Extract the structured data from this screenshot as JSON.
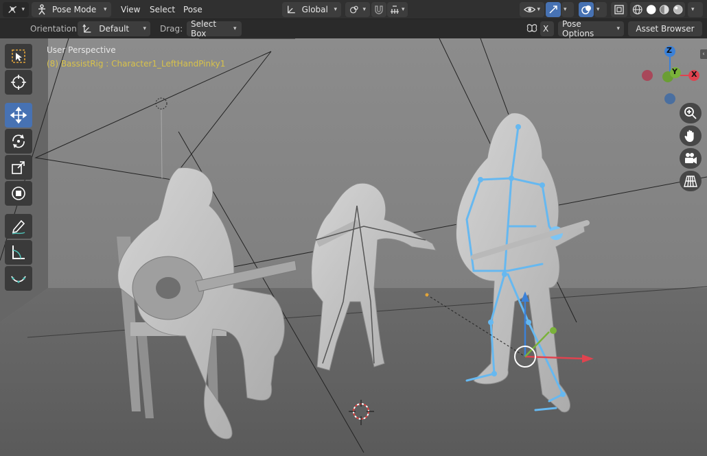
{
  "header": {
    "mode": "Pose Mode",
    "menus": [
      "View",
      "Select",
      "Pose"
    ],
    "transform_orientation": "Global"
  },
  "toolbar2": {
    "orientation_label": "Orientation:",
    "orientation_value": "Default",
    "drag_label": "Drag:",
    "drag_value": "Select Box",
    "x_label": "X",
    "pose_options": "Pose Options",
    "asset_browser": "Asset Browser"
  },
  "viewport": {
    "title": "User Perspective",
    "object_info": "(8) BassistRig : Character1_LeftHandPinky1"
  },
  "gizmo": {
    "z": "Z",
    "y": "Y",
    "x": "X"
  },
  "tools": [
    "select-box",
    "cursor",
    "move",
    "rotate",
    "scale",
    "transform",
    "annotate",
    "measure",
    "relax"
  ],
  "colors": {
    "accent": "#4772b3",
    "bone": "#66b8f0",
    "active_bone": "#7fd08a",
    "x_axis": "#e0434f",
    "y_axis": "#7ab23a",
    "z_axis": "#3b81d8"
  }
}
